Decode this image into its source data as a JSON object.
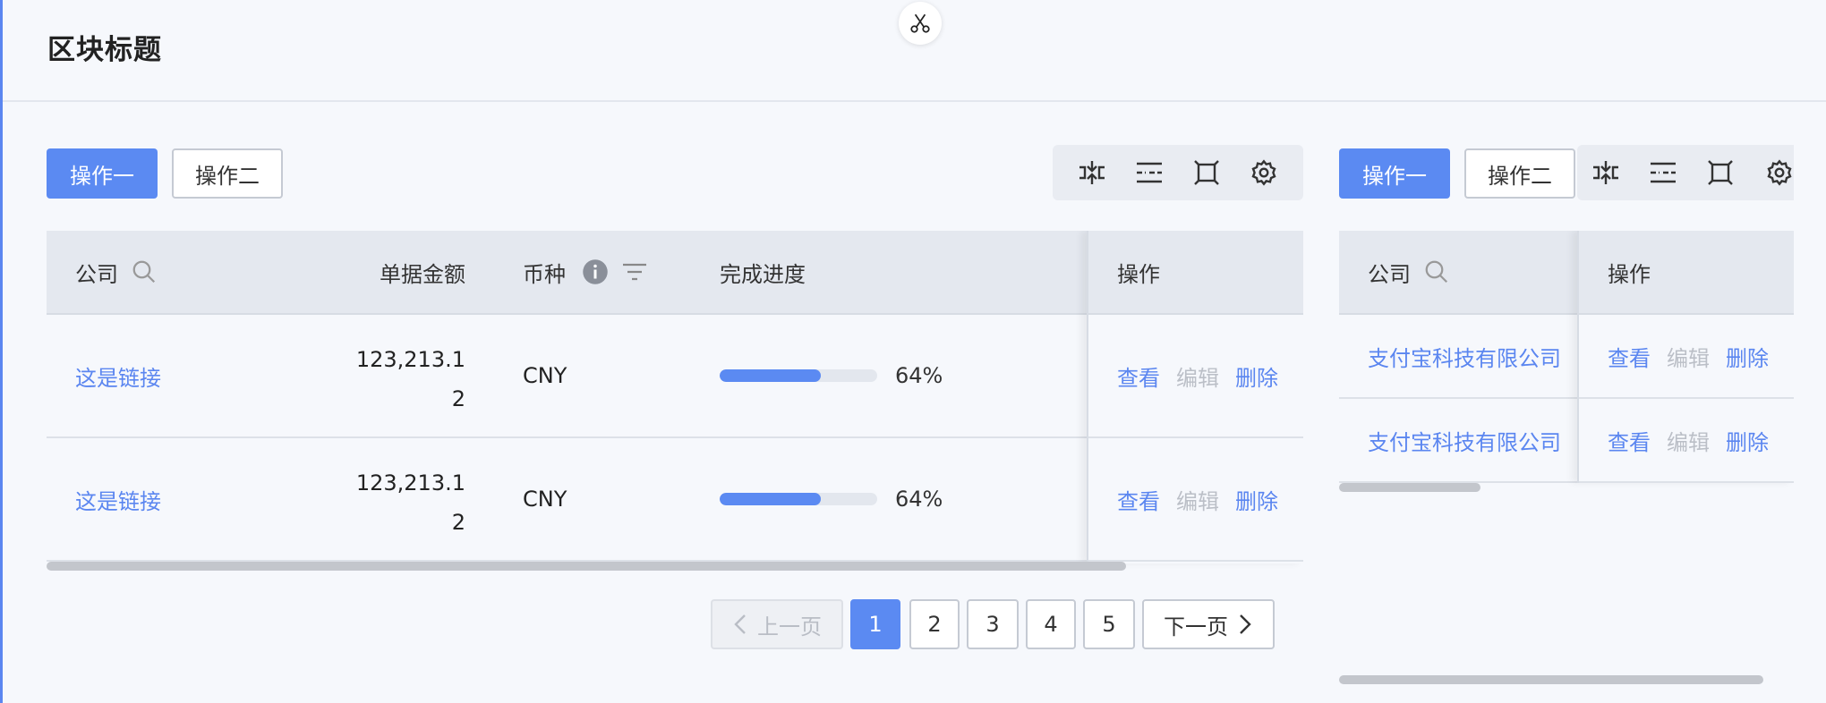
{
  "header": {
    "title": "区块标题"
  },
  "left_panel": {
    "actions": {
      "primary": "操作一",
      "secondary": "操作二"
    },
    "toolbar_icons": [
      "density-icon",
      "column-settings-icon",
      "fullscreen-icon",
      "settings-icon"
    ],
    "columns": {
      "company": "公司",
      "amount": "单据金额",
      "currency": "币种",
      "progress": "完成进度",
      "operation": "操作"
    },
    "rows": [
      {
        "company": "这是链接",
        "amount_line1": "123,213.1",
        "amount_line2": "2",
        "currency": "CNY",
        "progress": 0.64,
        "progress_label": "64%",
        "view": "查看",
        "edit": "编辑",
        "delete": "删除"
      },
      {
        "company": "这是链接",
        "amount_line1": "123,213.1",
        "amount_line2": "2",
        "currency": "CNY",
        "progress": 0.64,
        "progress_label": "64%",
        "view": "查看",
        "edit": "编辑",
        "delete": "删除"
      }
    ],
    "pagination": {
      "prev": "上一页",
      "next": "下一页",
      "pages": [
        "1",
        "2",
        "3",
        "4",
        "5"
      ],
      "current": "1"
    }
  },
  "right_panel": {
    "actions": {
      "primary": "操作一",
      "secondary": "操作二"
    },
    "columns": {
      "company": "公司",
      "operation": "操作"
    },
    "rows": [
      {
        "company": "支付宝科技有限公司",
        "view": "查看",
        "edit": "编辑",
        "delete": "删除"
      },
      {
        "company": "支付宝科技有限公司",
        "view": "查看",
        "edit": "编辑",
        "delete": "删除"
      }
    ]
  },
  "colors": {
    "primary": "#5b8af2",
    "link": "#5b86f0",
    "disabled": "#bbbfc7",
    "accent_bar": "#5b86f0"
  }
}
